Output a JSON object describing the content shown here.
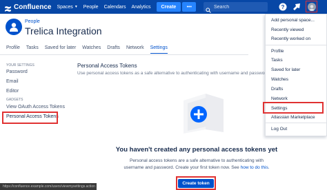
{
  "colors": {
    "brand": "#0747a6",
    "accent": "#0052cc",
    "highlight": "#e03131"
  },
  "header": {
    "app_name": "Confluence",
    "nav": [
      {
        "label": "Spaces",
        "has_caret": true
      },
      {
        "label": "People"
      },
      {
        "label": "Calendars"
      },
      {
        "label": "Analytics"
      }
    ],
    "create_label": "Create",
    "more_label": "•••",
    "search_placeholder": "Search",
    "icons": [
      "confluence-logo-icon",
      "search-icon",
      "help-icon",
      "notifications-icon",
      "avatar"
    ]
  },
  "space": {
    "breadcrumb": "People",
    "title": "Trelica Integration"
  },
  "tabs": [
    {
      "label": "Profile"
    },
    {
      "label": "Tasks"
    },
    {
      "label": "Saved for later"
    },
    {
      "label": "Watches"
    },
    {
      "label": "Drafts"
    },
    {
      "label": "Network"
    },
    {
      "label": "Settings",
      "active": true
    }
  ],
  "sidebar": {
    "your_settings_heading": "YOUR SETTINGS",
    "password": "Password",
    "email": "Email",
    "editor": "Editor",
    "gadgets_heading": "GADGETS",
    "view_oauth": "View OAuth Access Tokens",
    "personal_tokens": "Personal Access Tokens"
  },
  "main": {
    "section_title": "Personal Access Tokens",
    "section_desc": "Use personal access tokens as a safe alternative to authenticating with username and password.",
    "empty_title": "You haven't created any personal access tokens yet",
    "empty_desc_1": "Personal access tokens are a safe alternative to authenticating with",
    "empty_desc_2": "username and password. Create your first token now. See",
    "how_to_link": "how to do this",
    "empty_desc_end": ".",
    "create_token_label": "Create token"
  },
  "status_bar_url": "https://confluence.example.com/users/viewmysettings.action",
  "user_menu": {
    "items_group1": [
      "Add personal space...",
      "Recently viewed",
      "Recently worked on"
    ],
    "items_group2": [
      "Profile",
      "Tasks",
      "Saved for later",
      "Watches",
      "Drafts",
      "Network",
      "Settings",
      "Atlassian Marketplace"
    ],
    "logout": "Log Out",
    "highlighted": "Settings"
  }
}
